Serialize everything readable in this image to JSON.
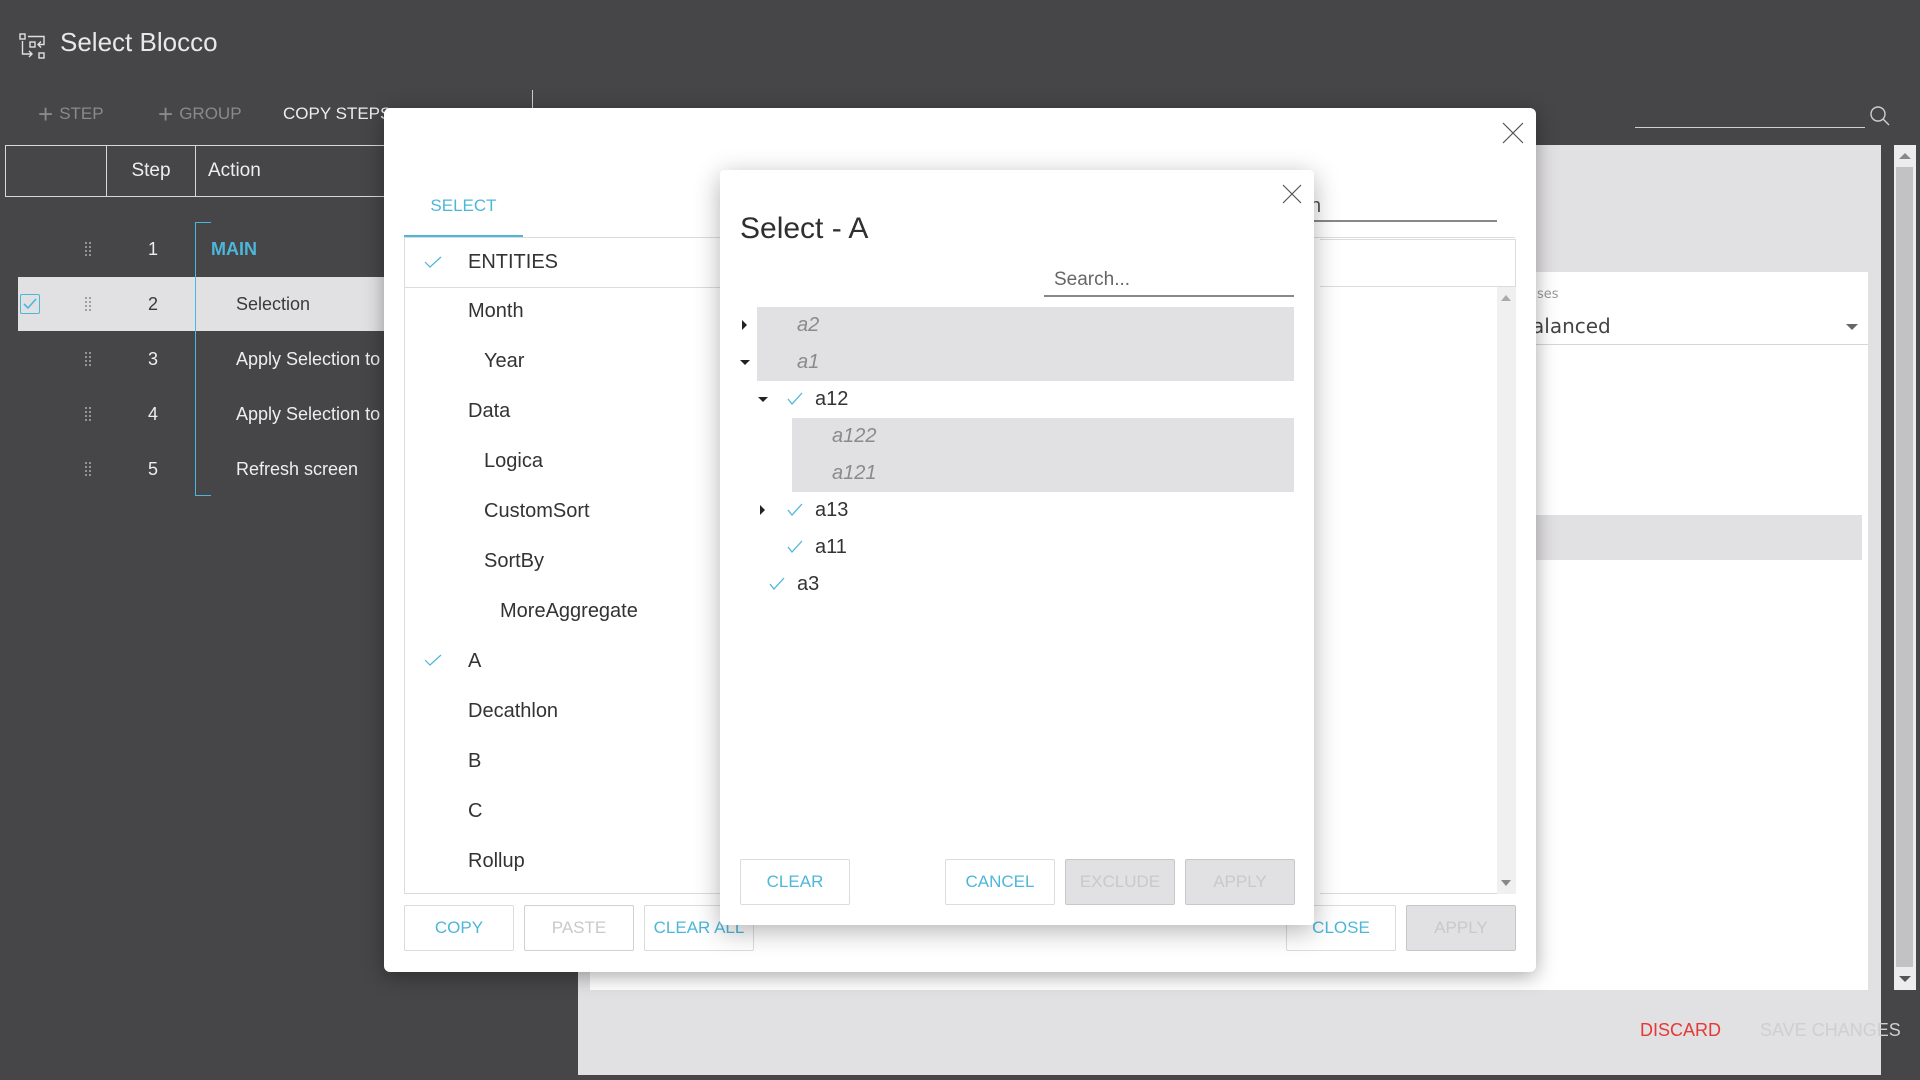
{
  "app": {
    "title": "Select Blocco",
    "title_icon": "workflow-blocks-icon"
  },
  "toolbar": {
    "step_label": "STEP",
    "group_label": "GROUP",
    "copy_steps_label": "COPY STEPS",
    "search_placeholder": ""
  },
  "steps_table": {
    "headers": [
      "",
      "Step",
      "Action"
    ],
    "rows": [
      {
        "step": "1",
        "action": "MAIN",
        "selected": false,
        "is_group": true
      },
      {
        "step": "2",
        "action": "Selection",
        "selected": true,
        "is_group": false
      },
      {
        "step": "3",
        "action": "Apply Selection to",
        "selected": false,
        "is_group": false
      },
      {
        "step": "4",
        "action": "Apply Selection to",
        "selected": false,
        "is_group": false
      },
      {
        "step": "5",
        "action": "Refresh screen",
        "selected": false,
        "is_group": false
      }
    ]
  },
  "background_panel": {
    "field_label": "ses",
    "field_value": "alanced",
    "discard_label": "DISCARD",
    "save_changes_label": "SAVE CHANGES"
  },
  "outer_dialog": {
    "tab_label": "SELECT",
    "search_value": "h",
    "items": [
      {
        "label": "ENTITIES",
        "checked": true,
        "indent": 0
      },
      {
        "label": "Month",
        "checked": false,
        "indent": 0
      },
      {
        "label": "Year",
        "checked": false,
        "indent": 1
      },
      {
        "label": "Data",
        "checked": false,
        "indent": 0
      },
      {
        "label": "Logica",
        "checked": false,
        "indent": 1
      },
      {
        "label": "CustomSort",
        "checked": false,
        "indent": 1
      },
      {
        "label": "SortBy",
        "checked": false,
        "indent": 1
      },
      {
        "label": "MoreAggregate",
        "checked": false,
        "indent": 2
      },
      {
        "label": "A",
        "checked": true,
        "indent": 0
      },
      {
        "label": "Decathlon",
        "checked": false,
        "indent": 0
      },
      {
        "label": "B",
        "checked": false,
        "indent": 0
      },
      {
        "label": "C",
        "checked": false,
        "indent": 0
      },
      {
        "label": "Rollup",
        "checked": false,
        "indent": 0
      }
    ],
    "buttons": {
      "copy": "COPY",
      "paste": "PASTE",
      "clear_all": "CLEAR ALL",
      "close": "CLOSE",
      "apply": "APPLY"
    }
  },
  "select_dialog": {
    "title": "Select - A",
    "search_placeholder": "Search...",
    "search_value": "",
    "tree": [
      {
        "label": "a2",
        "level": 0,
        "expander": "collapsed",
        "checked": false,
        "excluded": true
      },
      {
        "label": "a1",
        "level": 0,
        "expander": "expanded",
        "checked": false,
        "excluded": true
      },
      {
        "label": "a12",
        "level": 1,
        "expander": "expanded",
        "checked": true,
        "excluded": false
      },
      {
        "label": "a122",
        "level": 2,
        "expander": "none",
        "checked": false,
        "excluded": true
      },
      {
        "label": "a121",
        "level": 2,
        "expander": "none",
        "checked": false,
        "excluded": true
      },
      {
        "label": "a13",
        "level": 1,
        "expander": "collapsed",
        "checked": true,
        "excluded": false
      },
      {
        "label": "a11",
        "level": 1,
        "expander": "none",
        "checked": true,
        "excluded": false
      },
      {
        "label": "a3",
        "level": 0,
        "expander": "none",
        "checked": true,
        "excluded": false
      }
    ],
    "buttons": {
      "clear": "CLEAR",
      "cancel": "CANCEL",
      "exclude": "EXCLUDE",
      "apply": "APPLY"
    }
  },
  "colors": {
    "accent": "#4cb7db",
    "danger": "#e53935",
    "background": "#464547",
    "highlight": "#e1e0e2"
  }
}
